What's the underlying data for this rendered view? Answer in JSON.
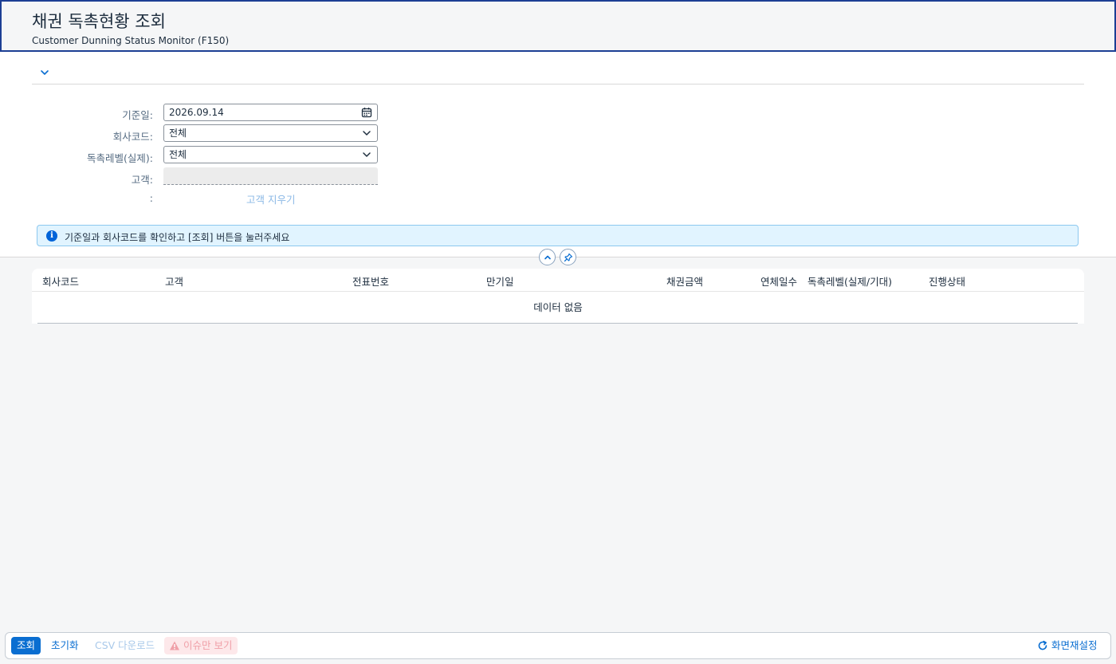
{
  "header": {
    "title": "채권 독촉현황 조회",
    "subtitle": "Customer Dunning Status Monitor (F150)"
  },
  "filter": {
    "toggle_icon": "chevron-down-icon",
    "fields": {
      "base_date": {
        "label": "기준일:",
        "value": "2026.09.14",
        "icon": "calendar-icon"
      },
      "company_code": {
        "label": "회사코드:",
        "value": "전체",
        "icon": "chevron-down-icon"
      },
      "dunning_level": {
        "label": "독촉레벨(실제):",
        "value": "전체",
        "icon": "chevron-down-icon"
      },
      "customer": {
        "label": "고객:",
        "value": ""
      },
      "customer_extra": {
        "label": ":"
      }
    },
    "clear_customer_link": "고객 지우기",
    "info_message": "기준일과 회사코드를 확인하고 [조회] 버튼을 눌러주세요"
  },
  "table": {
    "columns": [
      "회사코드",
      "고객",
      "전표번호",
      "만기일",
      "채권금액",
      "연체일수",
      "독촉레벨(실제/기대)",
      "진행상태"
    ],
    "empty_text": "데이터 없음"
  },
  "footer": {
    "search_label": "조회",
    "reset_label": "초기화",
    "csv_label": "CSV 다운로드",
    "issues_only_label": "이슈만 보기",
    "layout_settings_label": "화면재설정"
  },
  "colors": {
    "accent": "#0a6ed1",
    "header_border": "#1c3f94",
    "info_background": "#e1f4ff"
  }
}
